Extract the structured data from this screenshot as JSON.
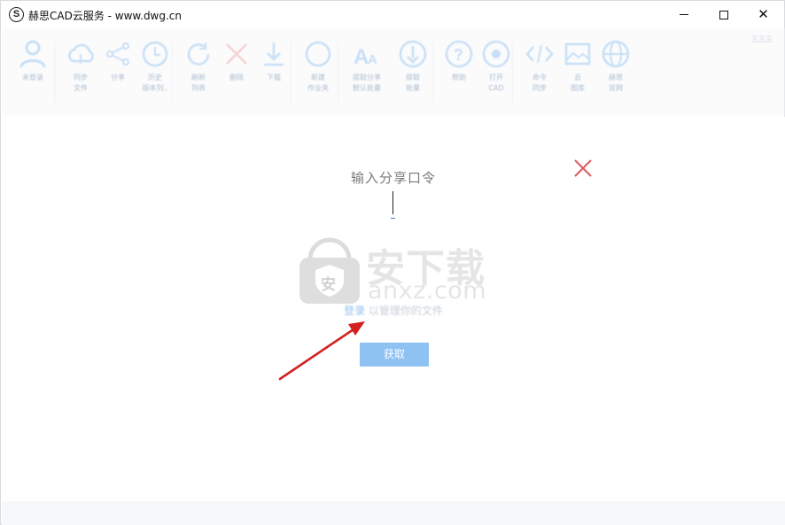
{
  "window": {
    "title": "赫思CAD云服务 - www.dwg.cn",
    "logo_letter": "S"
  },
  "window_controls": {
    "minimize": "minimize-icon",
    "maximize": "maximize-icon",
    "close_glyph": "✕"
  },
  "toolbar": {
    "corner_text": "三三三",
    "items": [
      {
        "label": "未登录",
        "icon": "user-icon"
      },
      {
        "label": "同步\n文件",
        "icon": "cloud-upload-icon"
      },
      {
        "label": "分享",
        "icon": "share-icon"
      },
      {
        "label": "历史\n版本列..",
        "icon": "history-icon"
      },
      {
        "label": "刷新\n列表",
        "icon": "refresh-icon"
      },
      {
        "label": "删除",
        "icon": "delete-icon"
      },
      {
        "label": "下载",
        "icon": "download-icon"
      },
      {
        "label": "新建\n作业夹",
        "icon": "new-folder-icon"
      },
      {
        "label": "提取分享\n默认批量",
        "icon": "font-icon"
      },
      {
        "label": "提取\n批量",
        "icon": "extract-icon"
      },
      {
        "label": "帮助",
        "icon": "help-icon"
      },
      {
        "label": "打开\nCAD",
        "icon": "play-icon"
      },
      {
        "label": "命令\n同步",
        "icon": "code-icon"
      },
      {
        "label": "云\n图库",
        "icon": "gallery-icon"
      },
      {
        "label": "赫思\n官网",
        "icon": "globe-icon"
      }
    ]
  },
  "dialog": {
    "prompt": "输入分享口令",
    "close_icon": "close-icon",
    "login_link": "登录",
    "login_hint": " 以管理你的文件",
    "get_button": "获取"
  },
  "watermark": {
    "big": "安下载",
    "small": "anxz.com",
    "shield_char": "安"
  },
  "colors": {
    "accent": "#8ec2f3",
    "close_red": "#e05a5a",
    "arrow_red": "#d42020",
    "toolbar_icon": "#9cc6ef"
  }
}
